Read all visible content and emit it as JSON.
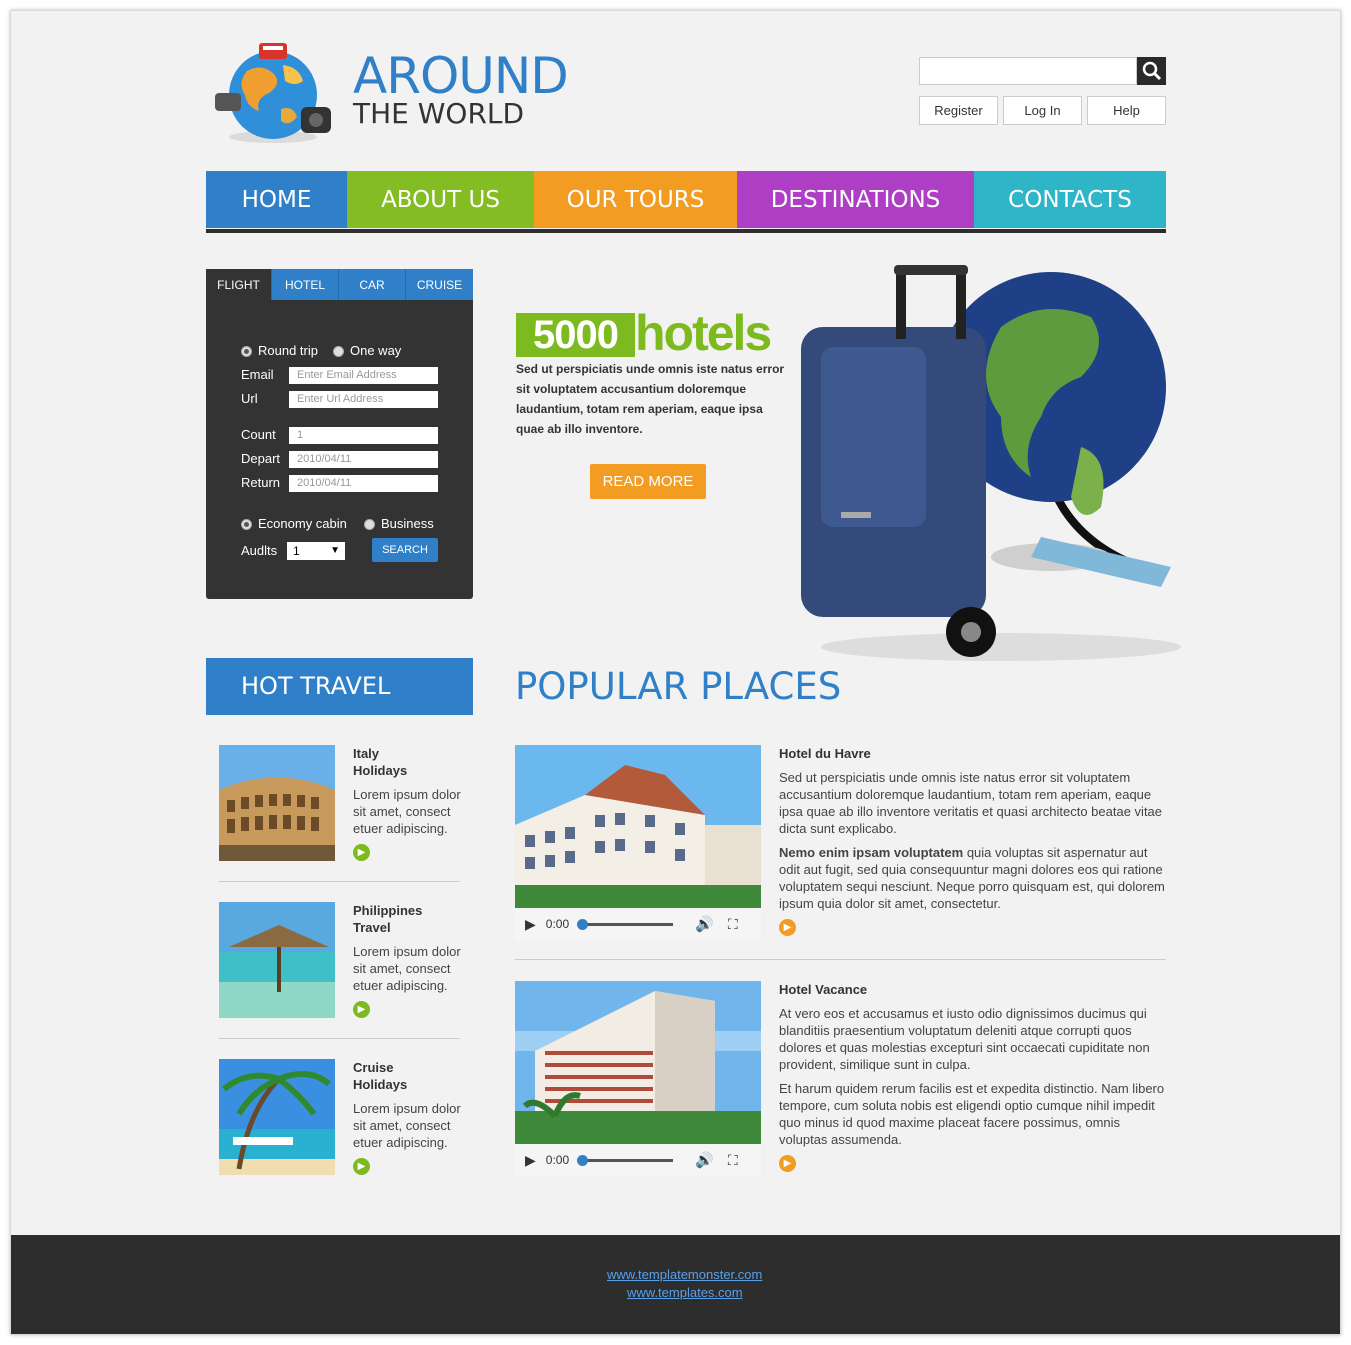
{
  "logo": {
    "line1": "AROUND",
    "line2": "THE WORLD"
  },
  "search": {
    "placeholder": "",
    "icon": "search-icon"
  },
  "top_links": [
    "Register",
    "Log In",
    "Help"
  ],
  "nav": [
    {
      "label": "HOME",
      "color": "#2f80c8"
    },
    {
      "label": "ABOUT US",
      "color": "#84bc23"
    },
    {
      "label": "OUR TOURS",
      "color": "#f39c22"
    },
    {
      "label": "DESTINATIONS",
      "color": "#ae3ec3"
    },
    {
      "label": "CONTACTS",
      "color": "#2fb5c8"
    }
  ],
  "booking": {
    "tabs": [
      "FLIGHT",
      "HOTEL",
      "CAR",
      "CRUISE"
    ],
    "trip_options": [
      "Round trip",
      "One way"
    ],
    "email_label": "Email",
    "email_placeholder": "Enter Email Address",
    "url_label": "Url",
    "url_placeholder": "Enter Url Address",
    "count_label": "Count",
    "count_value": "1",
    "depart_label": "Depart",
    "depart_value": "2010/04/11",
    "return_label": "Return",
    "return_value": "2010/04/11",
    "cabin_options": [
      "Economy cabin",
      "Business"
    ],
    "adults_label": "Audlts",
    "adults_value": "1",
    "search_label": "SEARCH"
  },
  "promo": {
    "number": "5000",
    "word": "hotels",
    "text": "Sed ut perspiciatis unde omnis iste natus error sit voluptatem accusantium doloremque laudantium, totam rem aperiam, eaque ipsa quae ab illo inventore.",
    "button": "READ MORE"
  },
  "hot_travel": {
    "heading": "HOT TRAVEL",
    "items": [
      {
        "title1": "Italy",
        "title2": "Holidays",
        "text": "Lorem ipsum dolor sit amet, consect etuer adipiscing."
      },
      {
        "title1": "Philippines",
        "title2": "Travel",
        "text": "Lorem ipsum dolor sit amet, consect etuer adipiscing."
      },
      {
        "title1": "Cruise",
        "title2": "Holidays",
        "text": "Lorem ipsum dolor sit amet, consect etuer adipiscing."
      }
    ]
  },
  "popular": {
    "heading": "POPULAR PLACES",
    "items": [
      {
        "title": "Hotel du Havre",
        "p1": "Sed ut perspiciatis unde omnis iste natus error sit voluptatem accusantium doloremque laudantium, totam rem aperiam, eaque ipsa quae ab illo inventore veritatis et quasi architecto beatae vitae dicta sunt explicabo.",
        "p2_bold": "Nemo enim ipsam voluptatem",
        "p2": " quia voluptas sit aspernatur aut odit aut fugit, sed quia consequuntur magni dolores eos qui ratione voluptatem sequi nesciunt. Neque porro quisquam est, qui dolorem ipsum quia dolor sit amet, consectetur.",
        "time": "0:00"
      },
      {
        "title": "Hotel Vacance",
        "p1": "At vero eos et accusamus et iusto odio dignissimos ducimus qui blanditiis praesentium voluptatum deleniti atque corrupti quos dolores et quas molestias excepturi sint occaecati cupiditate non provident, similique sunt in culpa.",
        "p2_bold": "",
        "p2": "Et harum quidem rerum facilis est et expedita distinctio. Nam libero tempore, cum soluta nobis est eligendi optio cumque nihil impedit quo minus id quod maxime placeat facere possimus, omnis voluptas assumenda.",
        "time": "0:00"
      }
    ]
  },
  "footer": {
    "links": [
      "www.templatemonster.com",
      "www.templates.com"
    ]
  },
  "colors": {
    "blue": "#2f80c8",
    "green": "#7cba1f",
    "orange": "#f39c22",
    "dark": "#333333"
  }
}
